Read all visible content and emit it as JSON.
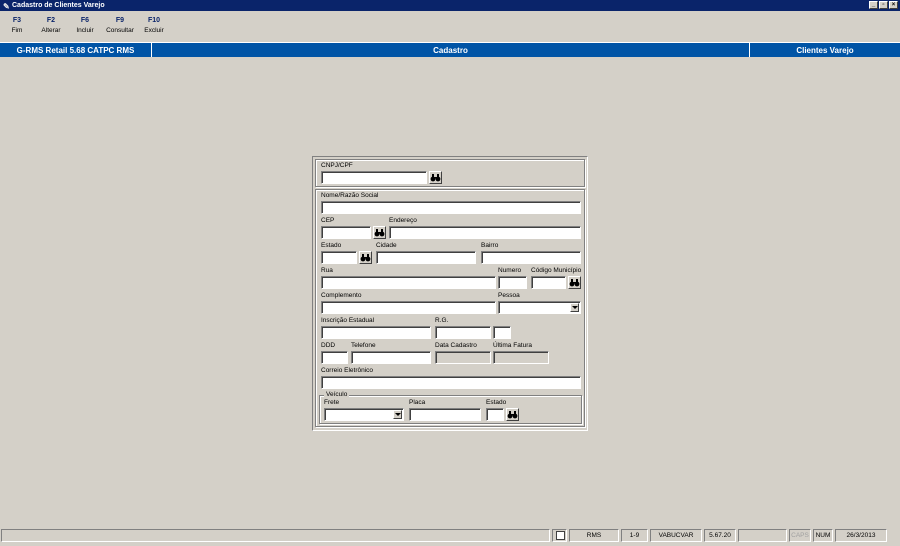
{
  "window": {
    "title": "Cadastro de Clientes Varejo"
  },
  "toolbar": [
    {
      "key": "F3",
      "label": "Fim"
    },
    {
      "key": "F2",
      "label": "Alterar"
    },
    {
      "key": "F6",
      "label": "Incluir"
    },
    {
      "key": "F9",
      "label": "Consultar"
    },
    {
      "key": "F10",
      "label": "Excluir"
    }
  ],
  "header": {
    "left": "G-RMS Retail 5.68 CATPC RMS",
    "center": "Cadastro",
    "right": "Clientes Varejo"
  },
  "form": {
    "cnpj_label": "CNPJ/CPF",
    "nome_label": "Nome/Razão Social",
    "cep_label": "CEP",
    "endereco_label": "Endereço",
    "estado_label": "Estado",
    "cidade_label": "Cidade",
    "bairro_label": "Bairro",
    "rua_label": "Rua",
    "numero_label": "Numero",
    "codigo_municipio_label": "Código Município",
    "complemento_label": "Complemento",
    "pessoa_label": "Pessoa",
    "inscricao_label": "Inscrição Estadual",
    "rg_label": "R.G.",
    "ddd_label": "DDD",
    "telefone_label": "Telefone",
    "data_cadastro_label": "Data Cadastro",
    "ultima_fatura_label": "Última Fatura",
    "correio_label": "Correio Eletrônico",
    "veiculo_legend": "Veículo",
    "frete_label": "Frete",
    "placa_label": "Placa",
    "veiculo_estado_label": "Estado"
  },
  "status": {
    "rms": "RMS",
    "range": "1-9",
    "program": "VABUCVAR",
    "version": "5.67.20",
    "caps": "CAPS",
    "num": "NUM",
    "date": "26/3/2013"
  },
  "colors": {
    "titlebar": "#0a246a",
    "header": "#0054a6",
    "background": "#d4d0c8"
  },
  "icons": [
    "pen-icon",
    "binoculars-icon",
    "dropdown-arrow-icon",
    "document-icon"
  ]
}
